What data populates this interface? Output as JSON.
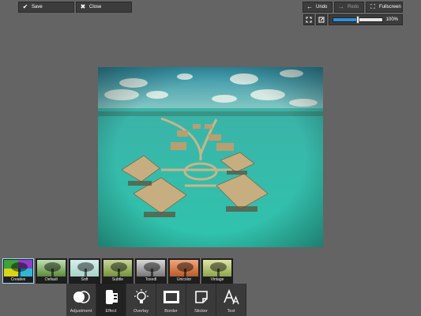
{
  "toolbar": {
    "save_label": "Save",
    "close_label": "Close",
    "undo_label": "Undo",
    "redo_label": "Redo",
    "fullscreen_label": "Fullscreen"
  },
  "zoom": {
    "label": "100%",
    "slider_level": 0.5
  },
  "effects": [
    {
      "label": "Creative",
      "colors": [
        "#3fa33b",
        "#d9d41a",
        "#8f3fc9",
        "#2fb7d7"
      ]
    },
    {
      "label": "Default",
      "colors": [
        "#bfe1b3",
        "#5b8a3a"
      ]
    },
    {
      "label": "Soft",
      "colors": [
        "#d7f0ee",
        "#a7d3c6"
      ]
    },
    {
      "label": "Subtle",
      "colors": [
        "#c9d69a",
        "#75923d"
      ]
    },
    {
      "label": "Toxedl",
      "colors": [
        "#d8d8d8",
        "#777777"
      ]
    },
    {
      "label": "Unicolor",
      "colors": [
        "#f0a67b",
        "#b85a2a"
      ]
    },
    {
      "label": "Vintage",
      "colors": [
        "#dfe6a5",
        "#8ea44e"
      ]
    }
  ],
  "selected_effect": "Creative",
  "tools": [
    {
      "label": "Adjustment",
      "icon": "contrast-circles-icon"
    },
    {
      "label": "Effect",
      "icon": "film-roll-icon"
    },
    {
      "label": "Overlay",
      "icon": "light-bulb-icon"
    },
    {
      "label": "Border",
      "icon": "frame-icon"
    },
    {
      "label": "Sticker",
      "icon": "sticker-icon"
    },
    {
      "label": "Text",
      "icon": "text-aa-icon"
    }
  ],
  "selected_tool": "Effect",
  "colors": {
    "background": "#646464",
    "panel": "#3c3c3c",
    "accent": "#2f8fd6"
  }
}
